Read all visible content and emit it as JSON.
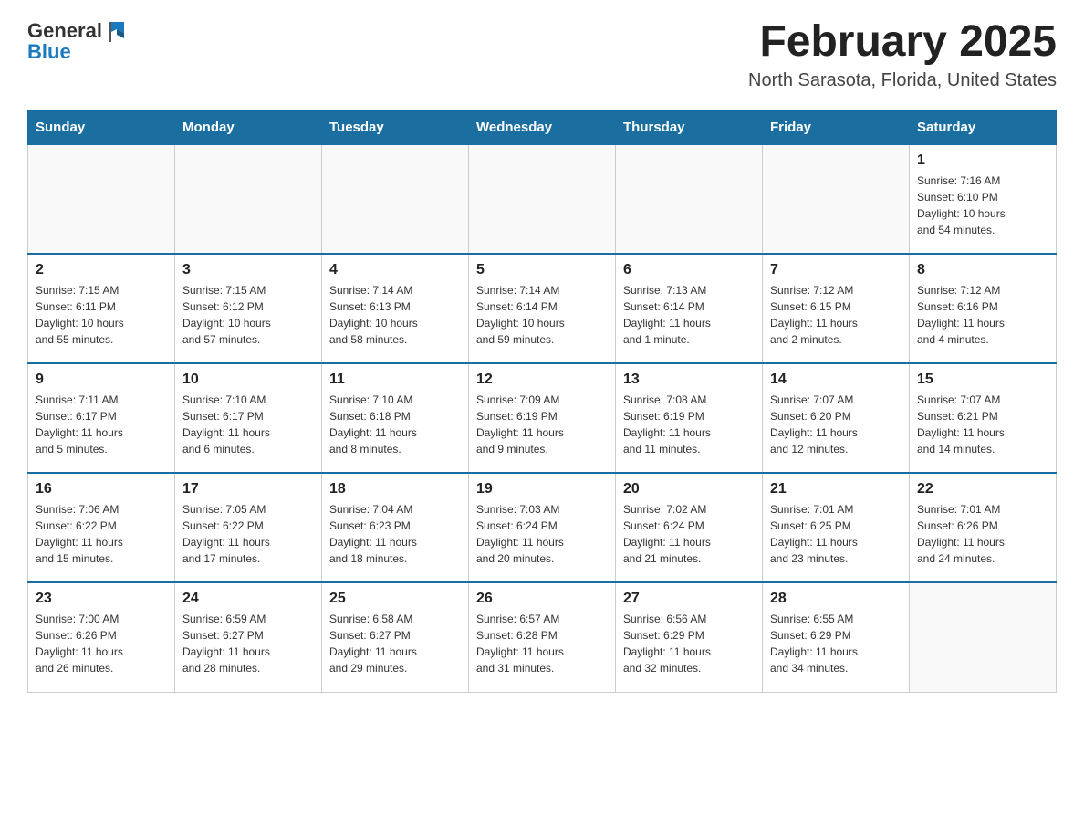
{
  "header": {
    "logo_general": "General",
    "logo_blue": "Blue",
    "title": "February 2025",
    "subtitle": "North Sarasota, Florida, United States"
  },
  "days_of_week": [
    "Sunday",
    "Monday",
    "Tuesday",
    "Wednesday",
    "Thursday",
    "Friday",
    "Saturday"
  ],
  "weeks": [
    [
      {
        "day": "",
        "info": ""
      },
      {
        "day": "",
        "info": ""
      },
      {
        "day": "",
        "info": ""
      },
      {
        "day": "",
        "info": ""
      },
      {
        "day": "",
        "info": ""
      },
      {
        "day": "",
        "info": ""
      },
      {
        "day": "1",
        "info": "Sunrise: 7:16 AM\nSunset: 6:10 PM\nDaylight: 10 hours\nand 54 minutes."
      }
    ],
    [
      {
        "day": "2",
        "info": "Sunrise: 7:15 AM\nSunset: 6:11 PM\nDaylight: 10 hours\nand 55 minutes."
      },
      {
        "day": "3",
        "info": "Sunrise: 7:15 AM\nSunset: 6:12 PM\nDaylight: 10 hours\nand 57 minutes."
      },
      {
        "day": "4",
        "info": "Sunrise: 7:14 AM\nSunset: 6:13 PM\nDaylight: 10 hours\nand 58 minutes."
      },
      {
        "day": "5",
        "info": "Sunrise: 7:14 AM\nSunset: 6:14 PM\nDaylight: 10 hours\nand 59 minutes."
      },
      {
        "day": "6",
        "info": "Sunrise: 7:13 AM\nSunset: 6:14 PM\nDaylight: 11 hours\nand 1 minute."
      },
      {
        "day": "7",
        "info": "Sunrise: 7:12 AM\nSunset: 6:15 PM\nDaylight: 11 hours\nand 2 minutes."
      },
      {
        "day": "8",
        "info": "Sunrise: 7:12 AM\nSunset: 6:16 PM\nDaylight: 11 hours\nand 4 minutes."
      }
    ],
    [
      {
        "day": "9",
        "info": "Sunrise: 7:11 AM\nSunset: 6:17 PM\nDaylight: 11 hours\nand 5 minutes."
      },
      {
        "day": "10",
        "info": "Sunrise: 7:10 AM\nSunset: 6:17 PM\nDaylight: 11 hours\nand 6 minutes."
      },
      {
        "day": "11",
        "info": "Sunrise: 7:10 AM\nSunset: 6:18 PM\nDaylight: 11 hours\nand 8 minutes."
      },
      {
        "day": "12",
        "info": "Sunrise: 7:09 AM\nSunset: 6:19 PM\nDaylight: 11 hours\nand 9 minutes."
      },
      {
        "day": "13",
        "info": "Sunrise: 7:08 AM\nSunset: 6:19 PM\nDaylight: 11 hours\nand 11 minutes."
      },
      {
        "day": "14",
        "info": "Sunrise: 7:07 AM\nSunset: 6:20 PM\nDaylight: 11 hours\nand 12 minutes."
      },
      {
        "day": "15",
        "info": "Sunrise: 7:07 AM\nSunset: 6:21 PM\nDaylight: 11 hours\nand 14 minutes."
      }
    ],
    [
      {
        "day": "16",
        "info": "Sunrise: 7:06 AM\nSunset: 6:22 PM\nDaylight: 11 hours\nand 15 minutes."
      },
      {
        "day": "17",
        "info": "Sunrise: 7:05 AM\nSunset: 6:22 PM\nDaylight: 11 hours\nand 17 minutes."
      },
      {
        "day": "18",
        "info": "Sunrise: 7:04 AM\nSunset: 6:23 PM\nDaylight: 11 hours\nand 18 minutes."
      },
      {
        "day": "19",
        "info": "Sunrise: 7:03 AM\nSunset: 6:24 PM\nDaylight: 11 hours\nand 20 minutes."
      },
      {
        "day": "20",
        "info": "Sunrise: 7:02 AM\nSunset: 6:24 PM\nDaylight: 11 hours\nand 21 minutes."
      },
      {
        "day": "21",
        "info": "Sunrise: 7:01 AM\nSunset: 6:25 PM\nDaylight: 11 hours\nand 23 minutes."
      },
      {
        "day": "22",
        "info": "Sunrise: 7:01 AM\nSunset: 6:26 PM\nDaylight: 11 hours\nand 24 minutes."
      }
    ],
    [
      {
        "day": "23",
        "info": "Sunrise: 7:00 AM\nSunset: 6:26 PM\nDaylight: 11 hours\nand 26 minutes."
      },
      {
        "day": "24",
        "info": "Sunrise: 6:59 AM\nSunset: 6:27 PM\nDaylight: 11 hours\nand 28 minutes."
      },
      {
        "day": "25",
        "info": "Sunrise: 6:58 AM\nSunset: 6:27 PM\nDaylight: 11 hours\nand 29 minutes."
      },
      {
        "day": "26",
        "info": "Sunrise: 6:57 AM\nSunset: 6:28 PM\nDaylight: 11 hours\nand 31 minutes."
      },
      {
        "day": "27",
        "info": "Sunrise: 6:56 AM\nSunset: 6:29 PM\nDaylight: 11 hours\nand 32 minutes."
      },
      {
        "day": "28",
        "info": "Sunrise: 6:55 AM\nSunset: 6:29 PM\nDaylight: 11 hours\nand 34 minutes."
      },
      {
        "day": "",
        "info": ""
      }
    ]
  ]
}
